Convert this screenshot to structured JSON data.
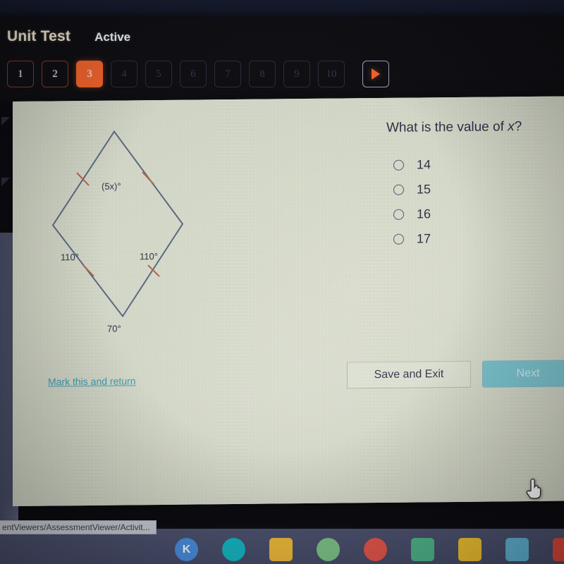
{
  "header": {
    "test_title": "Unit Test",
    "status": "Active",
    "questions": [
      {
        "label": "1",
        "state": "answered"
      },
      {
        "label": "2",
        "state": "answered"
      },
      {
        "label": "3",
        "state": "current"
      },
      {
        "label": "4",
        "state": "locked"
      },
      {
        "label": "5",
        "state": "locked"
      },
      {
        "label": "6",
        "state": "locked"
      },
      {
        "label": "7",
        "state": "locked"
      },
      {
        "label": "8",
        "state": "locked"
      },
      {
        "label": "9",
        "state": "locked"
      },
      {
        "label": "10",
        "state": "locked"
      }
    ],
    "next_nav_icon": "play-triangle-icon",
    "accent_color": "#f2632c"
  },
  "question": {
    "prompt_before": "What is the value of ",
    "prompt_variable": "x",
    "prompt_after": "?",
    "choices": [
      {
        "label": "14",
        "selected": false
      },
      {
        "label": "15",
        "selected": false
      },
      {
        "label": "16",
        "selected": false
      },
      {
        "label": "17",
        "selected": false
      }
    ]
  },
  "figure": {
    "type": "rhombus",
    "description": "Rhombus with congruent tick marks on all four sides",
    "angle_top": "(5x)°",
    "angle_left": "110°",
    "angle_right": "110°",
    "angle_bottom": "70°",
    "stroke_color": "#5b6a86",
    "tick_color": "#b5654a"
  },
  "footer": {
    "mark_link": "Mark this and return",
    "save_button": "Save and Exit",
    "next_button": "Next",
    "link_color": "#3e9ab0",
    "next_color": "#7bc4cf"
  },
  "os": {
    "status_text": "entViewers/AssessmentViewer/Activit...",
    "tray_icons": [
      {
        "name": "kahoot-icon",
        "glyph": "K",
        "color": "#4a90e2"
      },
      {
        "name": "video-camera-icon",
        "glyph": "",
        "color": "#14b8c4"
      },
      {
        "name": "google-slides-icon",
        "glyph": "",
        "color": "#f0bb3a"
      },
      {
        "name": "google-maps-icon",
        "glyph": "",
        "color": "#7fc48a"
      },
      {
        "name": "chrome-icon",
        "glyph": "",
        "color": "#e8564a"
      },
      {
        "name": "google-sheets-icon",
        "glyph": "",
        "color": "#4fb88c"
      },
      {
        "name": "google-drive-icon",
        "glyph": "",
        "color": "#f3c331"
      },
      {
        "name": "google-docs-icon",
        "glyph": "",
        "color": "#61b6d8"
      },
      {
        "name": "gmail-icon",
        "glyph": "",
        "color": "#e0483a"
      }
    ]
  }
}
